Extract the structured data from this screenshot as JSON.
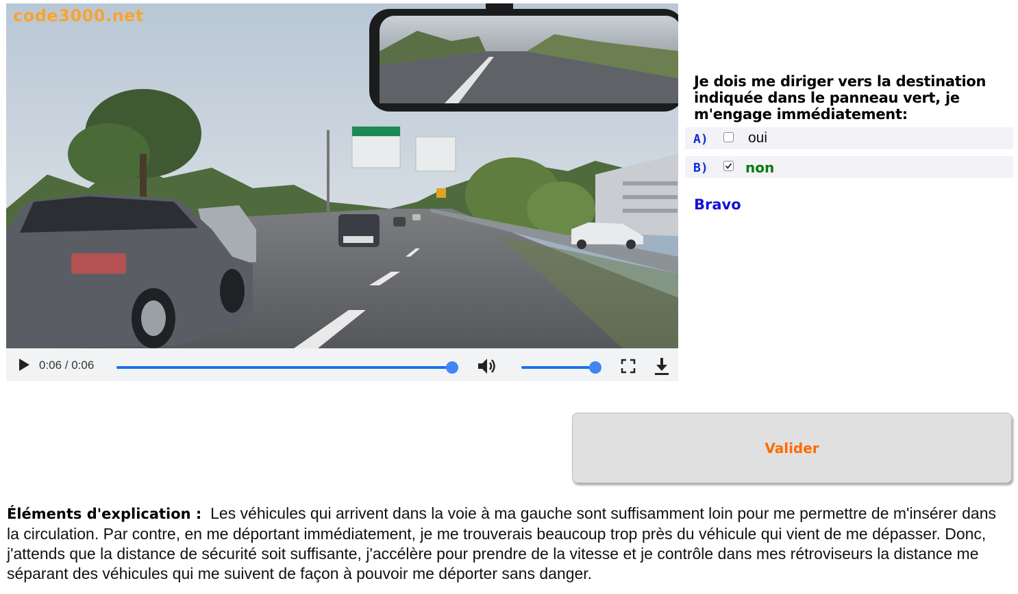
{
  "video": {
    "watermark": "code3000.net",
    "time_display": "0:06 / 0:06",
    "progress_fraction": 1.0,
    "volume_fraction": 1.0,
    "icons": {
      "play": "play-icon",
      "volume": "volume-icon",
      "fullscreen": "fullscreen-icon",
      "download": "download-icon"
    },
    "accent_color": "#1a73e8"
  },
  "question": {
    "text": "Je dois me diriger vers la destination indiquée dans le panneau vert, je m'engage immédiatement:",
    "answers": [
      {
        "letter": "A)",
        "label": "oui",
        "checked": false
      },
      {
        "letter": "B)",
        "label": "non",
        "checked": true
      }
    ],
    "feedback": "Bravo"
  },
  "validate_button": {
    "label": "Valider",
    "color": "#ff6a00"
  },
  "explanation": {
    "lead": "Éléments d'explication :",
    "text": "Les véhicules qui arrivent dans la voie à ma gauche sont suffisamment loin pour me permettre de m'insérer dans la circulation. Par contre, en me déportant immédiatement, je me trouverais beaucoup trop près du véhicule qui vient de me dépasser. Donc, j'attends que la distance de sécurité soit suffisante, j'accélère pour prendre de la vitesse et je contrôle dans mes rétroviseurs la distance me séparant des véhicules qui me suivent de façon à pouvoir me déporter sans danger."
  },
  "colors": {
    "answer_letter": "#0d2bd6",
    "correct_answer": "#0b7a0b",
    "feedback": "#1212d6"
  }
}
